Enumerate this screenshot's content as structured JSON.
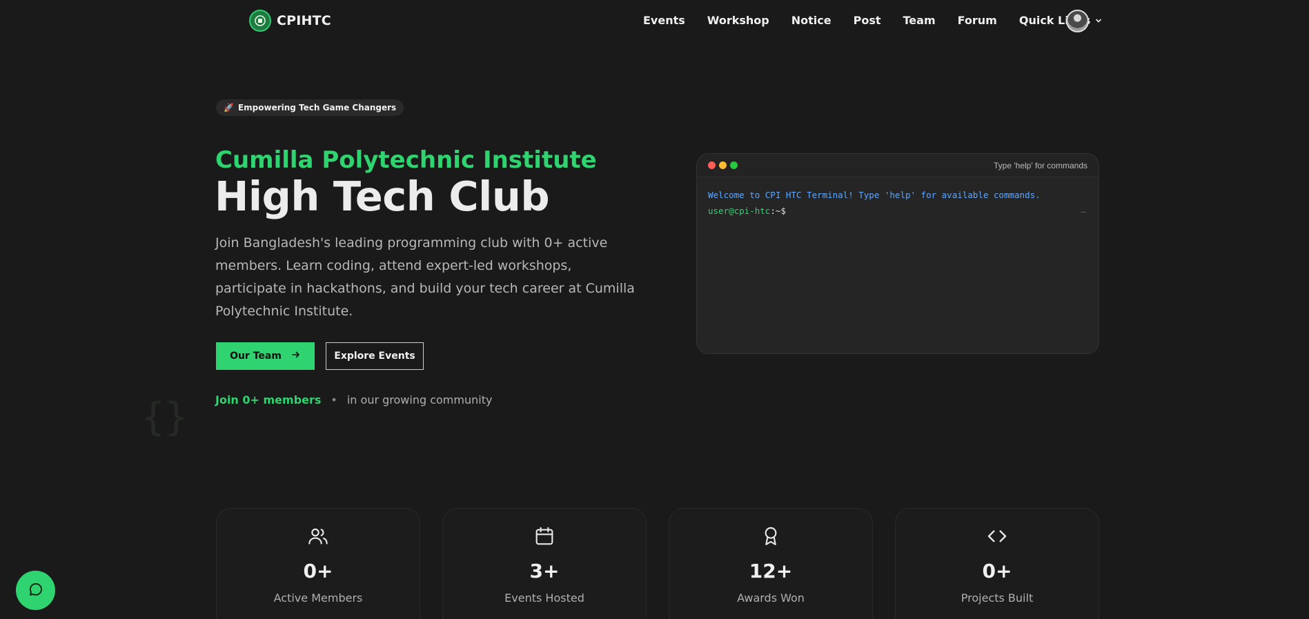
{
  "nav": {
    "brand": "CPIHTC",
    "links": [
      "Events",
      "Workshop",
      "Notice",
      "Post",
      "Team",
      "Forum"
    ],
    "quick_links": "Quick Links",
    "chevron_icon": "chevron-down-icon"
  },
  "hero": {
    "tag": "Empowering Tech Game Changers",
    "tag_icon": "rocket-icon",
    "subtitle": "Cumilla Polytechnic Institute",
    "title": "High Tech Club",
    "description": "Join Bangladesh's leading programming club with 0+ active members. Learn coding, attend expert-led workshops, participate in hackathons, and build your tech career at Cumilla Polytechnic Institute.",
    "primary_button": "Our Team",
    "secondary_button": "Explore Events",
    "join_strong": "Join 0+ members",
    "join_dot": "•",
    "join_rest": "in our growing community",
    "deco": "{}"
  },
  "terminal": {
    "hint": "Type 'help' for commands",
    "welcome": "Welcome to CPI HTC Terminal! Type 'help' for available commands.",
    "prompt_user": "user@cpi-htc",
    "prompt_sep": ":~$",
    "cursor": "_"
  },
  "stats": [
    {
      "icon": "users-icon",
      "value": "0+",
      "label": "Active Members"
    },
    {
      "icon": "calendar-icon",
      "value": "3+",
      "label": "Events Hosted"
    },
    {
      "icon": "award-icon",
      "value": "12+",
      "label": "Awards Won"
    },
    {
      "icon": "code-icon",
      "value": "0+",
      "label": "Projects Built"
    }
  ],
  "colors": {
    "background": "#1a1a1a",
    "accent": "#2fd36f",
    "terminal_blue": "#5fa8ff"
  }
}
